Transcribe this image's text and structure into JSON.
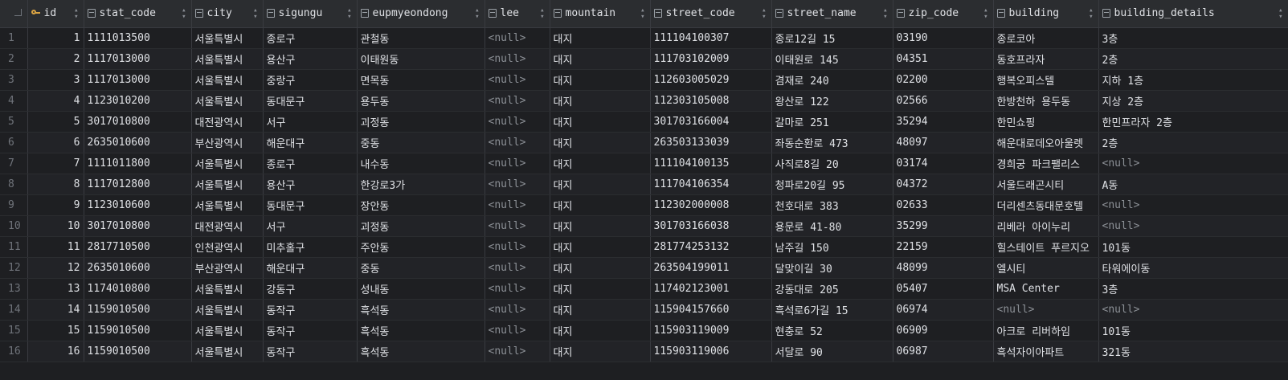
{
  "columns": [
    {
      "name": "id",
      "icon": "primary-key-icon"
    },
    {
      "name": "stat_code",
      "icon": "column-icon"
    },
    {
      "name": "city",
      "icon": "column-icon"
    },
    {
      "name": "sigungu",
      "icon": "column-icon"
    },
    {
      "name": "eupmyeondong",
      "icon": "column-icon"
    },
    {
      "name": "lee",
      "icon": "column-icon"
    },
    {
      "name": "mountain",
      "icon": "column-icon"
    },
    {
      "name": "street_code",
      "icon": "column-icon"
    },
    {
      "name": "street_name",
      "icon": "column-icon"
    },
    {
      "name": "zip_code",
      "icon": "column-icon"
    },
    {
      "name": "building",
      "icon": "column-icon"
    },
    {
      "name": "building_details",
      "icon": "column-icon"
    }
  ],
  "null_text": "<null>",
  "rows": [
    [
      "1",
      "1",
      "1111013500",
      "서울특별시",
      "종로구",
      "관철동",
      "<null>",
      "대지",
      "111104100307",
      "종로12길 15",
      "03190",
      "종로코아",
      "3층"
    ],
    [
      "2",
      "2",
      "1117013000",
      "서울특별시",
      "용산구",
      "이태원동",
      "<null>",
      "대지",
      "111703102009",
      "이태원로 145",
      "04351",
      "동호프라자",
      "2층"
    ],
    [
      "3",
      "3",
      "1117013000",
      "서울특별시",
      "중랑구",
      "면목동",
      "<null>",
      "대지",
      "112603005029",
      "겸재로 240",
      "02200",
      "행복오피스텔",
      "지하 1층"
    ],
    [
      "4",
      "4",
      "1123010200",
      "서울특별시",
      "동대문구",
      "용두동",
      "<null>",
      "대지",
      "112303105008",
      "왕산로 122",
      "02566",
      "한방천하 용두동",
      "지상 2층"
    ],
    [
      "5",
      "5",
      "3017010800",
      "대전광역시",
      "서구",
      "괴정동",
      "<null>",
      "대지",
      "301703166004",
      "갈마로 251",
      "35294",
      "한민쇼핑",
      "한민프라자 2층"
    ],
    [
      "6",
      "6",
      "2635010600",
      "부산광역시",
      "해운대구",
      "중동",
      "<null>",
      "대지",
      "263503133039",
      "좌동순환로 473",
      "48097",
      "해운대로데오아울렛",
      "2층"
    ],
    [
      "7",
      "7",
      "1111011800",
      "서울특별시",
      "종로구",
      "내수동",
      "<null>",
      "대지",
      "111104100135",
      "사직로8길 20",
      "03174",
      "경희궁 파크팰리스",
      "<null>"
    ],
    [
      "8",
      "8",
      "1117012800",
      "서울특별시",
      "용산구",
      "한강로3가",
      "<null>",
      "대지",
      "111704106354",
      "청파로20길 95",
      "04372",
      "서울드래곤시티",
      "A동"
    ],
    [
      "9",
      "9",
      "1123010600",
      "서울특별시",
      "동대문구",
      "장안동",
      "<null>",
      "대지",
      "112302000008",
      "천호대로 383",
      "02633",
      "더리센츠동대문호텔",
      "<null>"
    ],
    [
      "10",
      "10",
      "3017010800",
      "대전광역시",
      "서구",
      "괴정동",
      "<null>",
      "대지",
      "301703166038",
      "용문로 41-80",
      "35299",
      "리베라 아이누리",
      "<null>"
    ],
    [
      "11",
      "11",
      "2817710500",
      "인천광역시",
      "미추홀구",
      "주안동",
      "<null>",
      "대지",
      "281774253132",
      "남주길 150",
      "22159",
      "힐스테이트 푸르지오",
      "101동"
    ],
    [
      "12",
      "12",
      "2635010600",
      "부산광역시",
      "해운대구",
      "중동",
      "<null>",
      "대지",
      "263504199011",
      "달맞이길 30",
      "48099",
      "엘시티",
      "타워에이동"
    ],
    [
      "13",
      "13",
      "1174010800",
      "서울특별시",
      "강동구",
      "성내동",
      "<null>",
      "대지",
      "117402123001",
      "강동대로 205",
      "05407",
      "MSA Center",
      "3층"
    ],
    [
      "14",
      "14",
      "1159010500",
      "서울특별시",
      "동작구",
      "흑석동",
      "<null>",
      "대지",
      "115904157660",
      "흑석로6가길 15",
      "06974",
      "<null>",
      "<null>"
    ],
    [
      "15",
      "15",
      "1159010500",
      "서울특별시",
      "동작구",
      "흑석동",
      "<null>",
      "대지",
      "115903119009",
      "현충로 52",
      "06909",
      "아크로 리버하임",
      "101동"
    ],
    [
      "16",
      "16",
      "1159010500",
      "서울특별시",
      "동작구",
      "흑석동",
      "<null>",
      "대지",
      "115903119006",
      "서달로 90",
      "06987",
      "흑석자이아파트",
      "321동"
    ]
  ]
}
